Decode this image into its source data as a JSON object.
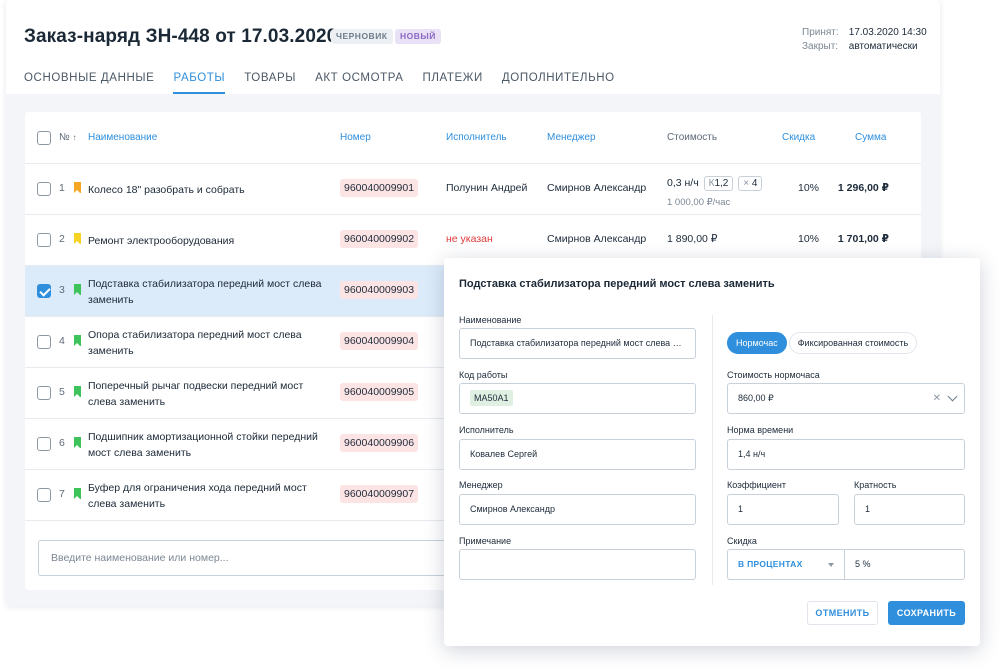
{
  "header": {
    "title": "Заказ-наряд ЗН-448 от 17.03.2020",
    "badges": [
      "ЧЕРНОВИК",
      "НОВЫЙ"
    ],
    "accepted_label": "Принят:",
    "accepted_value": "17.03.2020 14:30",
    "closed_label": "Закрыт:",
    "closed_value": "автоматически"
  },
  "tabs": [
    {
      "label": "ОСНОВНЫЕ ДАННЫЕ",
      "active": false
    },
    {
      "label": "РАБОТЫ",
      "active": true
    },
    {
      "label": "ТОВАРЫ",
      "active": false
    },
    {
      "label": "АКТ ОСМОТРА",
      "active": false
    },
    {
      "label": "ПЛАТЕЖИ",
      "active": false
    },
    {
      "label": "ДОПОЛНИТЕЛЬНО",
      "active": false
    }
  ],
  "table": {
    "columns": {
      "num": "№",
      "sort_arrow": "↑",
      "name": "Наименование",
      "code": "Номер",
      "executor": "Исполнитель",
      "manager": "Менеджер",
      "cost": "Стоимость",
      "discount": "Скидка",
      "sum": "Сумма"
    },
    "rows": [
      {
        "num": "1",
        "flag_color": "#f5a623",
        "name": "Колесо 18\" разобрать и собрать",
        "code": "960040009901",
        "executor": "Полунин Андрей",
        "manager": "Смирнов Александр",
        "cost": "0,3 н/ч",
        "k_label": "К",
        "k_value": "1,2",
        "x_label": "×",
        "x_value": "4",
        "subcost": "1 000,00 ₽/час",
        "discount": "10%",
        "sum": "1 296,00 ₽",
        "checked": false
      },
      {
        "num": "2",
        "flag_color": "#f5d223",
        "name": "Ремонт электрооборудования",
        "code": "960040009902",
        "executor": "не указан",
        "manager": "Смирнов Александр",
        "cost": "1 890,00 ₽",
        "discount": "10%",
        "sum": "1 701,00 ₽",
        "checked": false
      },
      {
        "num": "3",
        "flag_color": "#3ec25a",
        "name": "Подставка стабилизатора передний мост слева заменить",
        "code": "960040009903",
        "checked": true
      },
      {
        "num": "4",
        "flag_color": "#3ec25a",
        "name": "Опора стабилизатора передний мост слева заменить",
        "code": "960040009904",
        "checked": false
      },
      {
        "num": "5",
        "flag_color": "#3ec25a",
        "name": "Поперечный рычаг подвески передний мост слева заменить",
        "code": "960040009905",
        "checked": false
      },
      {
        "num": "6",
        "flag_color": "#3ec25a",
        "name": "Подшипник амортизационной стойки передний мост слева заменить",
        "code": "960040009906",
        "checked": false
      },
      {
        "num": "7",
        "flag_color": "#3ec25a",
        "name": "Буфер для ограничения хода передний мост слева заменить",
        "code": "960040009907",
        "checked": false
      }
    ],
    "search_placeholder": "Введите наименование или номер..."
  },
  "modal": {
    "title": "Подставка стабилизатора передний мост слева заменить",
    "name_label": "Наименование",
    "name_value": "Подставка стабилизатора передний мост слева за…",
    "code_label": "Код работы",
    "code_value": "MA50A1",
    "executor_label": "Исполнитель",
    "executor_value": "Ковалев Сергей",
    "manager_label": "Менеджер",
    "manager_value": "Смирнов Александр",
    "note_label": "Примечание",
    "note_value": "",
    "toggle_on": "Нормочас",
    "toggle_off": "Фиксированная стоимость",
    "hour_cost_label": "Стоимость нормочаса",
    "hour_cost_value": "860,00 ₽",
    "norm_label": "Норма времени",
    "norm_value": "1,4 н/ч",
    "coef_label": "Коэффициент",
    "coef_value": "1",
    "mult_label": "Кратность",
    "mult_value": "1",
    "discount_label": "Скидка",
    "discount_type": "В ПРОЦЕНТАХ",
    "discount_value": "5 %",
    "cancel": "ОТМЕНИТЬ",
    "save": "СОХРАНИТЬ"
  },
  "colors": {
    "accent": "#2f8fdd",
    "error": "#e03a3a",
    "selected_row": "#dcebfa",
    "code_badge": "#fde4e4"
  }
}
